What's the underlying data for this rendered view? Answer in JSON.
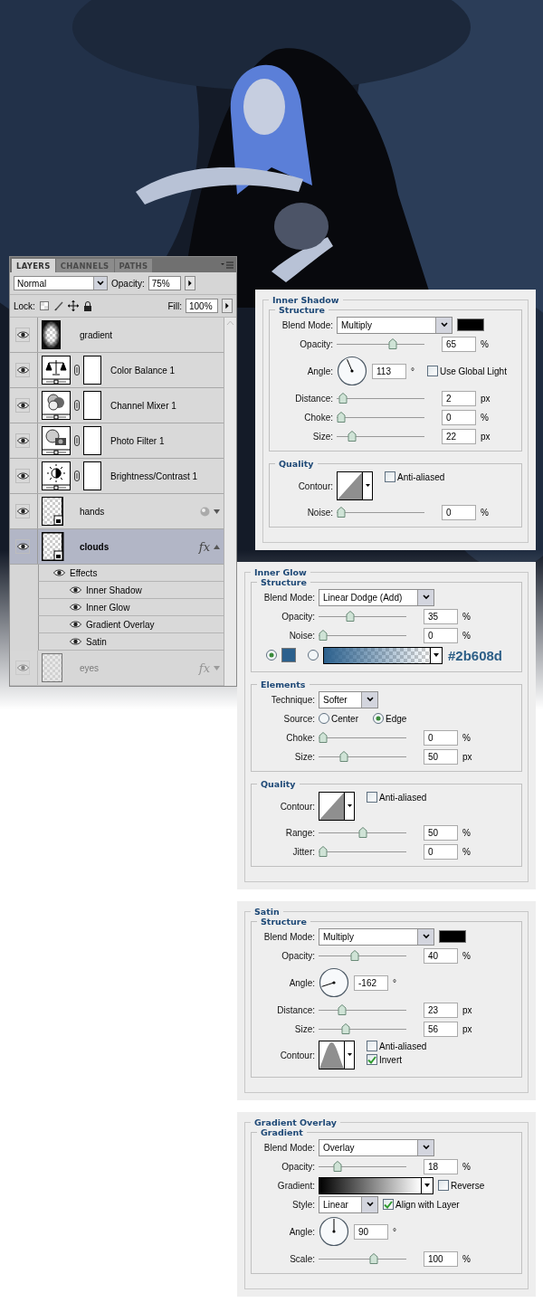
{
  "layers_panel": {
    "tabs": [
      {
        "label": "LAYERS",
        "selected": true
      },
      {
        "label": "CHANNELS",
        "selected": false
      },
      {
        "label": "PATHS",
        "selected": false
      }
    ],
    "blend_mode": "Normal",
    "opacity_label": "Opacity:",
    "opacity": "75%",
    "lock_label": "Lock:",
    "fill_label": "Fill:",
    "fill": "100%",
    "layers": [
      {
        "kind": "gradient",
        "name": "gradient",
        "visible": true,
        "selected": false
      },
      {
        "kind": "color_balance",
        "name": "Color Balance 1",
        "visible": true,
        "selected": false
      },
      {
        "kind": "channel_mixer",
        "name": "Channel Mixer 1",
        "visible": true,
        "selected": false
      },
      {
        "kind": "photo_filter",
        "name": "Photo Filter 1",
        "visible": true,
        "selected": false
      },
      {
        "kind": "brightness_contrast",
        "name": "Brightness/Contrast 1",
        "visible": true,
        "selected": false
      },
      {
        "kind": "smart",
        "name": "hands",
        "visible": true,
        "selected": false,
        "expanded": false
      },
      {
        "kind": "smart",
        "name": "clouds",
        "visible": true,
        "selected": true,
        "fx": "fx",
        "expanded": true,
        "effects_label": "Effects",
        "effects_visible": true,
        "effects": [
          {
            "name": "Inner Shadow",
            "visible": true
          },
          {
            "name": "Inner Glow",
            "visible": true
          },
          {
            "name": "Gradient Overlay",
            "visible": true
          },
          {
            "name": "Satin",
            "visible": true
          }
        ]
      },
      {
        "kind": "pixel",
        "name": "eyes",
        "visible": true,
        "selected": false,
        "fx": "fx",
        "expanded": false,
        "faded": true
      }
    ]
  },
  "style_panels": [
    {
      "title": "Inner Shadow",
      "sections": [
        {
          "title": "Structure",
          "rows": [
            {
              "kind": "select",
              "label": "Blend Mode:",
              "value": "Multiply",
              "color": "#000000"
            },
            {
              "kind": "slider",
              "label": "Opacity:",
              "level": 0.65,
              "value": "65",
              "unit": "%"
            },
            {
              "kind": "angle",
              "label": "Angle:",
              "value": "113",
              "unit": "°",
              "checkbox": {
                "label": "Use Global Light",
                "checked": false
              }
            },
            {
              "kind": "slider",
              "label": "Distance:",
              "level": 0.02,
              "value": "2",
              "unit": "px"
            },
            {
              "kind": "slider",
              "label": "Choke:",
              "level": 0,
              "value": "0",
              "unit": "%"
            },
            {
              "kind": "slider",
              "label": "Size:",
              "level": 0.14,
              "value": "22",
              "unit": "px"
            }
          ]
        },
        {
          "title": "Quality",
          "rows": [
            {
              "kind": "contour",
              "label": "Contour:",
              "checkboxes": [
                {
                  "label": "Anti-aliased",
                  "checked": false
                }
              ]
            },
            {
              "kind": "slider",
              "label": "Noise:",
              "level": 0,
              "value": "0",
              "unit": "%"
            }
          ]
        }
      ]
    },
    {
      "title": "Inner Glow",
      "sections": [
        {
          "title": "Structure",
          "rows": [
            {
              "kind": "select",
              "label": "Blend Mode:",
              "value": "Linear Dodge (Add)"
            },
            {
              "kind": "slider",
              "label": "Opacity:",
              "level": 0.35,
              "value": "35",
              "unit": "%"
            },
            {
              "kind": "slider",
              "label": "Noise:",
              "level": 0,
              "value": "0",
              "unit": "%"
            },
            {
              "kind": "fill_choice",
              "color": "#2b608d",
              "options": [
                {
                  "selected": true
                },
                {
                  "selected": false
                }
              ],
              "annotation": "#2b608d"
            }
          ]
        },
        {
          "title": "Elements",
          "rows": [
            {
              "kind": "short_select",
              "label": "Technique:",
              "value": "Softer"
            },
            {
              "kind": "radio",
              "label": "Source:",
              "options": [
                {
                  "label": "Center",
                  "selected": false
                },
                {
                  "label": "Edge",
                  "selected": true
                }
              ]
            },
            {
              "kind": "slider",
              "label": "Choke:",
              "level": 0,
              "value": "0",
              "unit": "%"
            },
            {
              "kind": "slider",
              "label": "Size:",
              "level": 0.26,
              "value": "50",
              "unit": "px"
            }
          ]
        },
        {
          "title": "Quality",
          "rows": [
            {
              "kind": "contour",
              "label": "Contour:",
              "checkboxes": [
                {
                  "label": "Anti-aliased",
                  "checked": false
                }
              ]
            },
            {
              "kind": "slider",
              "label": "Range:",
              "level": 0.5,
              "value": "50",
              "unit": "%"
            },
            {
              "kind": "slider",
              "label": "Jitter:",
              "level": 0,
              "value": "0",
              "unit": "%"
            }
          ]
        }
      ]
    },
    {
      "title": "Satin",
      "sections": [
        {
          "title": "Structure",
          "rows": [
            {
              "kind": "select",
              "label": "Blend Mode:",
              "value": "Multiply",
              "color": "#000000"
            },
            {
              "kind": "slider",
              "label": "Opacity:",
              "level": 0.4,
              "value": "40",
              "unit": "%"
            },
            {
              "kind": "angle",
              "label": "Angle:",
              "value": "-162",
              "unit": "°"
            },
            {
              "kind": "slider",
              "label": "Distance:",
              "level": 0.24,
              "value": "23",
              "unit": "px"
            },
            {
              "kind": "slider",
              "label": "Size:",
              "level": 0.29,
              "value": "56",
              "unit": "px"
            },
            {
              "kind": "cone_contour",
              "label": "Contour:",
              "checkboxes": [
                {
                  "label": "Anti-aliased",
                  "checked": false
                },
                {
                  "label": "Invert",
                  "checked": true
                }
              ]
            }
          ]
        }
      ]
    },
    {
      "title": "Gradient Overlay",
      "sections": [
        {
          "title": "Gradient",
          "rows": [
            {
              "kind": "select",
              "label": "Blend Mode:",
              "value": "Overlay"
            },
            {
              "kind": "slider",
              "label": "Opacity:",
              "level": 0.18,
              "value": "18",
              "unit": "%"
            },
            {
              "kind": "gradient",
              "label": "Gradient:",
              "checkbox": {
                "label": "Reverse",
                "checked": false
              }
            },
            {
              "kind": "short_select",
              "label": "Style:",
              "value": "Linear",
              "checkbox": {
                "label": "Align with Layer",
                "checked": true
              }
            },
            {
              "kind": "angle",
              "label": "Angle:",
              "value": "90",
              "unit": "°"
            },
            {
              "kind": "slider",
              "label": "Scale:",
              "level": 0.64,
              "value": "100",
              "unit": "%"
            }
          ]
        }
      ]
    }
  ]
}
